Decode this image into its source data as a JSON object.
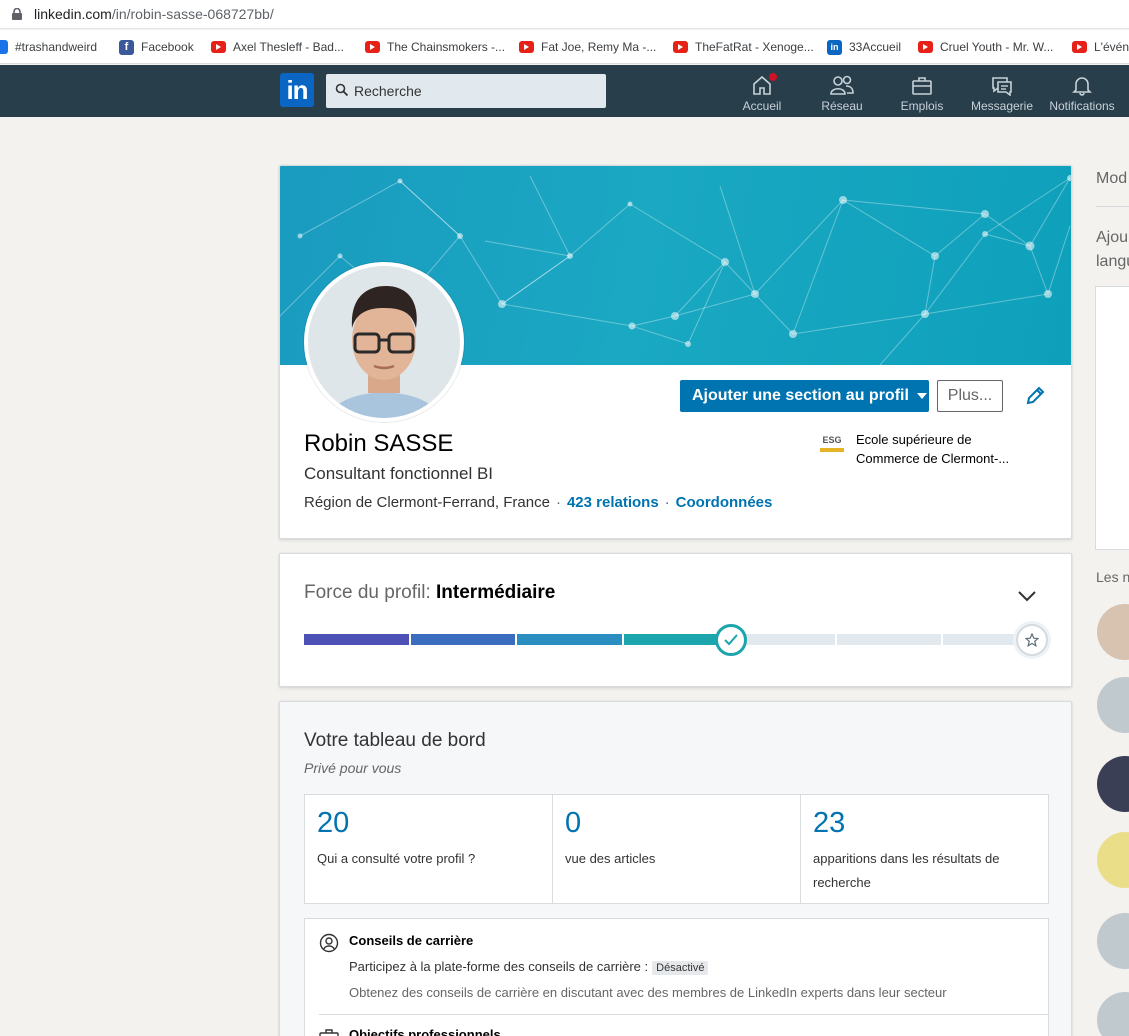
{
  "browser": {
    "url_host": "linkedin.com",
    "url_path": "/in/robin-sasse-068727bb/"
  },
  "bookmarks": [
    {
      "label": "#trashandweird",
      "icon": "calendar-icon"
    },
    {
      "label": "Facebook",
      "icon": "facebook-icon"
    },
    {
      "label": "Axel Thesleff - Bad...",
      "icon": "youtube-icon"
    },
    {
      "label": "The Chainsmokers -...",
      "icon": "youtube-icon"
    },
    {
      "label": "Fat Joe, Remy Ma -...",
      "icon": "youtube-icon"
    },
    {
      "label": "TheFatRat - Xenoge...",
      "icon": "youtube-icon"
    },
    {
      "label": "33Accueil",
      "icon": "linkedin-icon"
    },
    {
      "label": "Cruel Youth - Mr. W...",
      "icon": "youtube-icon"
    },
    {
      "label": "L'évén",
      "icon": "youtube-icon"
    }
  ],
  "nav": {
    "logo": "in",
    "search_placeholder": "Recherche",
    "items": [
      {
        "label": "Accueil",
        "icon": "home-icon"
      },
      {
        "label": "Réseau",
        "icon": "network-icon"
      },
      {
        "label": "Emplois",
        "icon": "briefcase-icon"
      },
      {
        "label": "Messagerie",
        "icon": "messaging-icon"
      },
      {
        "label": "Notifications",
        "icon": "bell-icon"
      }
    ]
  },
  "profile": {
    "name": "Robin SASSE",
    "headline": "Consultant fonctionnel BI",
    "location": "Région de Clermont-Ferrand, France",
    "connections": "423 relations",
    "contact": "Coordonnées",
    "add_section_button": "Ajouter une section au profil",
    "more_button": "Plus...",
    "school_logo": "ESG",
    "school_name": "Ecole supérieure de Commerce de Clermont-..."
  },
  "strength": {
    "label": "Force du profil:",
    "level": "Intermédiaire",
    "progress_segments_filled": 4,
    "progress_segments_total": 7
  },
  "dashboard": {
    "title": "Votre tableau de bord",
    "subtitle": "Privé pour vous",
    "stats": [
      {
        "value": "20",
        "caption": "Qui a consulté votre profil ?"
      },
      {
        "value": "0",
        "caption": "vue des articles"
      },
      {
        "value": "23",
        "caption": "apparitions dans les résultats de recherche"
      }
    ],
    "career": {
      "title": "Conseils de carrière",
      "line": "Participez à la plate-forme des conseils de carrière :",
      "status": "Désactivé",
      "description": "Obtenez des conseils de carrière en discutant avec des membres de LinkedIn experts dans leur secteur"
    },
    "goals_title": "Objectifs professionnels"
  },
  "rail": {
    "edit_partial": "Mod",
    "add_partial_1": "Ajou",
    "add_partial_2": "langu",
    "people_partial": "Les n"
  },
  "colors": {
    "nav_bg": "#283e4a",
    "accent": "#0073b1",
    "cover": "#1aa8c2"
  }
}
